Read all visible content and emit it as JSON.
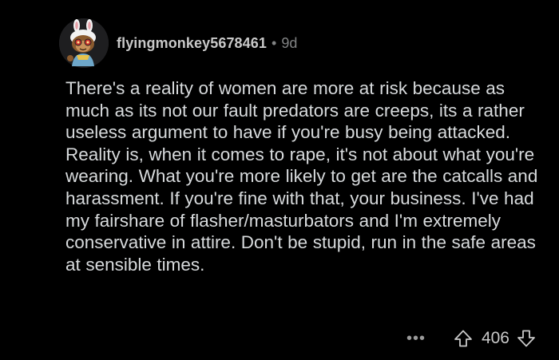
{
  "comment": {
    "username": "flyingmonkey5678461",
    "separator": "•",
    "age": "9d",
    "body": "There's a reality of women are more at risk because as much as its not our fault predators are creeps, its a rather useless argument to have if you're busy being attacked. Reality is, when it comes to rape, it's not about what you're wearing. What you're more likely to get are the catcalls and harassment. If you're fine with that, your business. I've had my fairshare of flasher/masturbators and I'm extremely conservative in attire. Don't be stupid, run in the safe areas at sensible times.",
    "score": "406",
    "more_label": "•••"
  },
  "icons": {
    "avatar": "monkey-avatar-icon",
    "upvote": "arrow-up-icon",
    "downvote": "arrow-down-icon",
    "more": "more-horizontal-icon"
  },
  "colors": {
    "background": "#000000",
    "text": "#d7dadc",
    "muted": "#818384"
  }
}
